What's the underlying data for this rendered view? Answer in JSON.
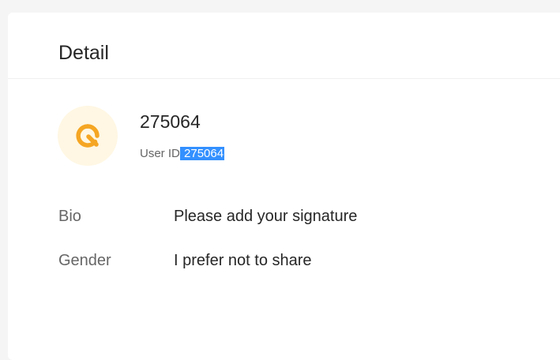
{
  "detail": {
    "title": "Detail"
  },
  "profile": {
    "avatar_icon": "logo-icon",
    "avatar_color": "#f5a623",
    "username": "275064",
    "user_id_label": "User ID",
    "user_id_value": "275064"
  },
  "info": {
    "bio_label": "Bio",
    "bio_value": "Please add your signature",
    "gender_label": "Gender",
    "gender_value": "I prefer not to share"
  }
}
